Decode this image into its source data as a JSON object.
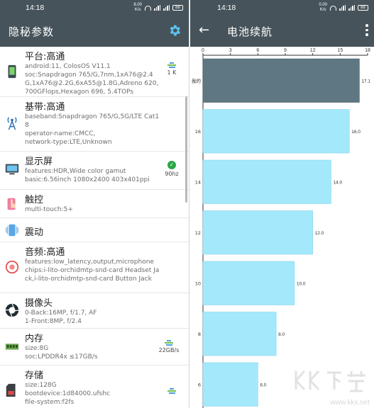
{
  "status_left": {
    "time": "14:18",
    "speed": [
      "8.00",
      "K/s"
    ]
  },
  "status_right": {
    "time": "14:18",
    "speed": [
      "0.00",
      "K/s"
    ]
  },
  "battery": "88",
  "left_title": "隐秘参数",
  "right_title": "电池续航",
  "items": [
    {
      "name": "平台:高通",
      "desc": "android:11, ColosOS V11.1\nsoc:Snapdragon 765/G,7nm,1xA76@2.4G,1xA76@2.2G,6xA55@1.8G,Adreno 620,700GFlops,Hexagon 696, 5.4TOPs",
      "side": "1 K"
    },
    {
      "name": "基带:高通",
      "desc": "baseband:Snapdragon 765/G,5G/LTE Cat18\noperator-name:CMCC,\nnetwork-type:LTE,Unknown",
      "side": ""
    },
    {
      "name": "显示屏",
      "desc": "features:HDR,Wide color gamut\nbasic:6.56inch 1080x2400 403x401ppi",
      "side": "90hz"
    },
    {
      "name": "触控",
      "desc": "multi-touch:5+",
      "side": ""
    },
    {
      "name": "震动",
      "desc": "",
      "side": ""
    },
    {
      "name": "音频:高通",
      "desc": "features:low_latency,output,microphone\nchips:i-lito-orchidmtp-snd-card Headset Jack,i-lito-orchidmtp-snd-card Button Jack",
      "side": ""
    },
    {
      "name": "摄像头",
      "desc": "0-Back:16MP, f/1.7, AF\n1-Front:8MP, f/2.4",
      "side": ""
    },
    {
      "name": "内存",
      "desc": "size:8G\nsoc:LPDDR4x ≤17GB/s",
      "side": "22GB/s"
    },
    {
      "name": "存储",
      "desc": "size:128G\nbootdevice:1d84000.ufshc\nfile-system:f2fs",
      "side": ""
    }
  ],
  "chart_data": {
    "type": "bar",
    "orientation": "horizontal",
    "title": "",
    "xlabel": "",
    "ylabel": "",
    "xlim": [
      0,
      18
    ],
    "xticks": [
      0,
      3,
      6,
      9,
      12,
      15,
      18
    ],
    "categories": [
      "我的",
      "16",
      "14",
      "12",
      "10",
      "8",
      "6"
    ],
    "values": [
      17.1,
      16.0,
      14.0,
      12.0,
      10.0,
      8.0,
      6.0
    ],
    "value_labels": [
      "17.1",
      "16.0",
      "14.0",
      "12.0",
      "10.0",
      "8.0",
      "6.0"
    ],
    "colors": {
      "highlight": "#5f7782",
      "bar": "#a4e8fb",
      "bar_edge": "#86d4ec"
    }
  },
  "watermark": {
    "text": "www.kkx.net",
    "logo": "KK下载"
  }
}
